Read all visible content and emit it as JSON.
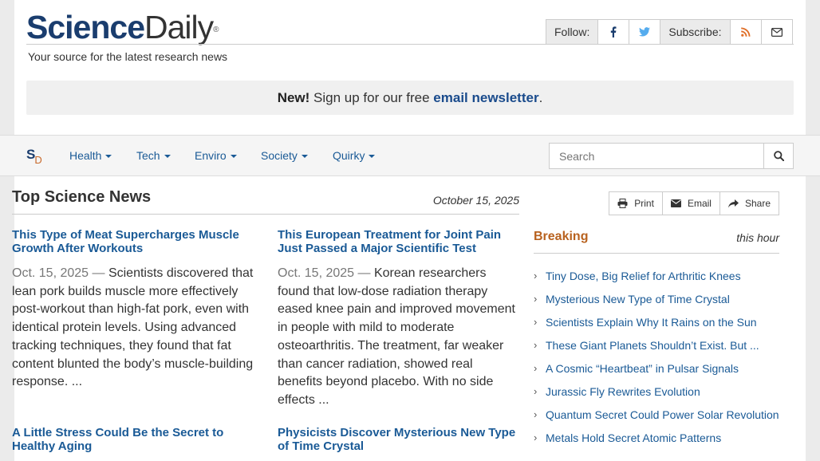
{
  "header": {
    "logo_science": "Science",
    "logo_daily": "Daily",
    "logo_reg": "®",
    "tagline": "Your source for the latest research news",
    "follow_label": "Follow:",
    "subscribe_label": "Subscribe:"
  },
  "banner": {
    "new": "New!",
    "text": " Sign up for our free ",
    "link": "email newsletter",
    "end": "."
  },
  "nav": {
    "logo_s": "S",
    "logo_d": "D",
    "items": [
      "Health",
      "Tech",
      "Enviro",
      "Society",
      "Quirky"
    ],
    "search_placeholder": "Search"
  },
  "main": {
    "title": "Top Science News",
    "date": "October 15, 2025",
    "stories": [
      {
        "headline": "This Type of Meat Supercharges Muscle Growth After Workouts",
        "date": "Oct. 15, 2025",
        "summary": "Scientists discovered that lean pork builds muscle more effectively post-workout than high-fat pork, even with identical protein levels. Using advanced tracking techniques, they found that fat content blunted the body’s muscle-building response. ..."
      },
      {
        "headline": "This European Treatment for Joint Pain Just Passed a Major Scientific Test",
        "date": "Oct. 15, 2025",
        "summary": "Korean researchers found that low-dose radiation therapy eased knee pain and improved movement in people with mild to moderate osteoarthritis. The treatment, far weaker than cancer radiation, showed real benefits beyond placebo. With no side effects ..."
      },
      {
        "headline": "A Little Stress Could Be the Secret to Healthy Aging"
      },
      {
        "headline": "Physicists Discover Mysterious New Type of Time Crystal"
      }
    ]
  },
  "sidebar": {
    "tools": [
      "Print",
      "Email",
      "Share"
    ],
    "title": "Breaking",
    "subtitle": "this hour",
    "items": [
      "Tiny Dose, Big Relief for Arthritic Knees",
      "Mysterious New Type of Time Crystal",
      "Scientists Explain Why It Rains on the Sun",
      "These Giant Planets Shouldn’t Exist. But ...",
      "A Cosmic “Heartbeat” in Pulsar Signals",
      "Jurassic Fly Rewrites Evolution",
      "Quantum Secret Could Power Solar Revolution",
      "Metals Hold Secret Atomic Patterns"
    ]
  },
  "colors": {
    "brand_blue": "#1a3d6e",
    "link_blue": "#1a5a96",
    "accent_orange": "#b8621f"
  },
  "icons": [
    "facebook-icon",
    "twitter-icon",
    "rss-icon",
    "envelope-icon",
    "search-icon",
    "print-icon",
    "share-icon",
    "chevron-right-icon"
  ]
}
